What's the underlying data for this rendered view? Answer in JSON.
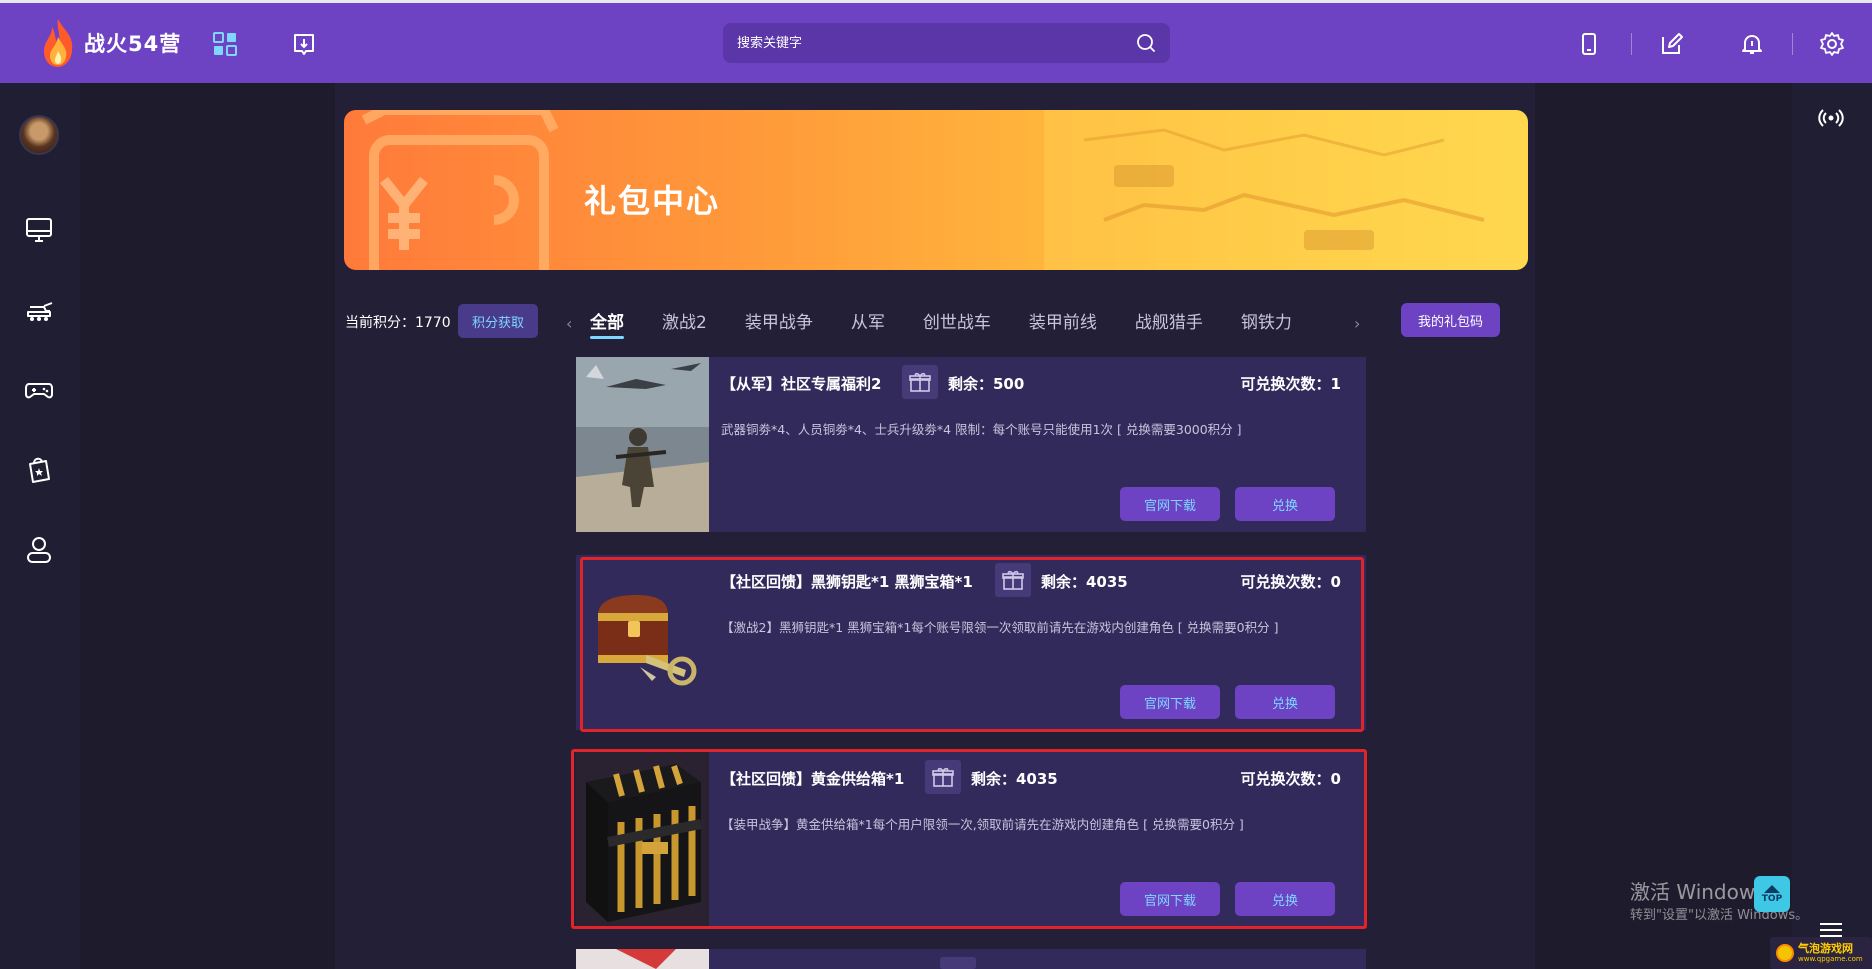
{
  "header": {
    "logo_text": "战火54营",
    "search_placeholder": "搜索关键字"
  },
  "banner": {
    "title": "礼包中心"
  },
  "points": {
    "label": "当前积分：1770",
    "earn_button": "积分获取"
  },
  "tabs": [
    "全部",
    "激战2",
    "装甲战争",
    "从军",
    "创世战车",
    "装甲前线",
    "战舰猎手",
    "钢铁力"
  ],
  "my_codes_button": "我的礼包码",
  "cards": [
    {
      "title": "【从军】社区专属福利2",
      "remain": "剩余：500",
      "times": "可兑换次数：1",
      "desc": "武器铜劵*4、人员铜劵*4、士兵升级劵*4 限制：每个账号只能使用1次 [ 兑换需要3000积分 ]",
      "download": "官网下载",
      "exchange": "兑换"
    },
    {
      "title": "【社区回馈】黑狮钥匙*1 黑狮宝箱*1",
      "remain": "剩余：4035",
      "times": "可兑换次数：0",
      "desc": "【激战2】黑狮钥匙*1 黑狮宝箱*1每个账号限领一次领取前请先在游戏内创建角色 [ 兑换需要0积分 ]",
      "download": "官网下载",
      "exchange": "兑换"
    },
    {
      "title": "【社区回馈】黄金供给箱*1",
      "remain": "剩余：4035",
      "times": "可兑换次数：0",
      "desc": "【装甲战争】黄金供给箱*1每个用户限领一次,领取前请先在游戏内创建角色 [ 兑换需要0积分 ]",
      "download": "官网下载",
      "exchange": "兑换"
    }
  ],
  "watermark": {
    "line1": "激活 Windows",
    "line2": "转到\"设置\"以激活 Windows。"
  },
  "top_button": "TOP",
  "site_logo": {
    "name": "气泡游戏网",
    "url_text": "www.qpgame.com"
  },
  "colors": {
    "accent": "#6d43c4",
    "card": "#332a5c",
    "highlight": "#e2242a",
    "link": "#7ed7ff"
  }
}
